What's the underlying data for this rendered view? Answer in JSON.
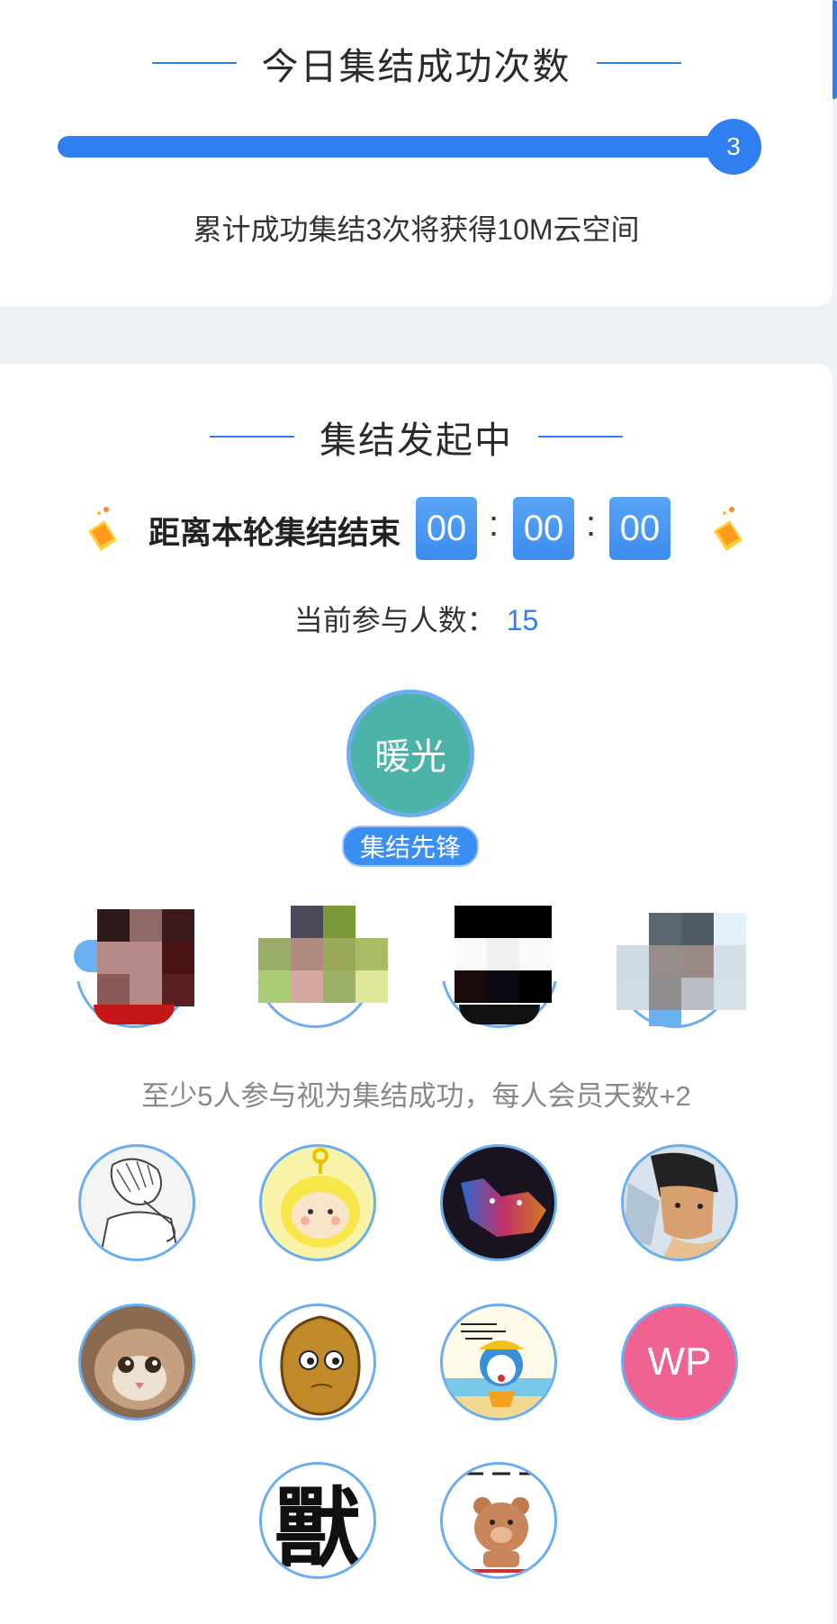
{
  "success_card": {
    "title": "今日集结成功次数",
    "progress_value": 3,
    "progress_fraction": 1.0,
    "reward_text": "累计成功集结3次将获得10M云空间"
  },
  "rally_card": {
    "title": "集结发起中",
    "countdown_label": "距离本轮集结结束",
    "hours": "00",
    "minutes": "00",
    "seconds": "00",
    "separator": ":",
    "participants_label": "当前参与人数：",
    "participants_count": "15",
    "leader_name": "暖光",
    "leader_badge": "集结先锋",
    "rule_text": "至少5人参与视为集结成功，每人会员天数+2",
    "member_initials": "WP",
    "member_glyph": "獸"
  },
  "colors": {
    "accent": "#2f7ff0",
    "leader_avatar_bg": "#4db3a8",
    "wp_avatar_bg": "#ef6291"
  }
}
